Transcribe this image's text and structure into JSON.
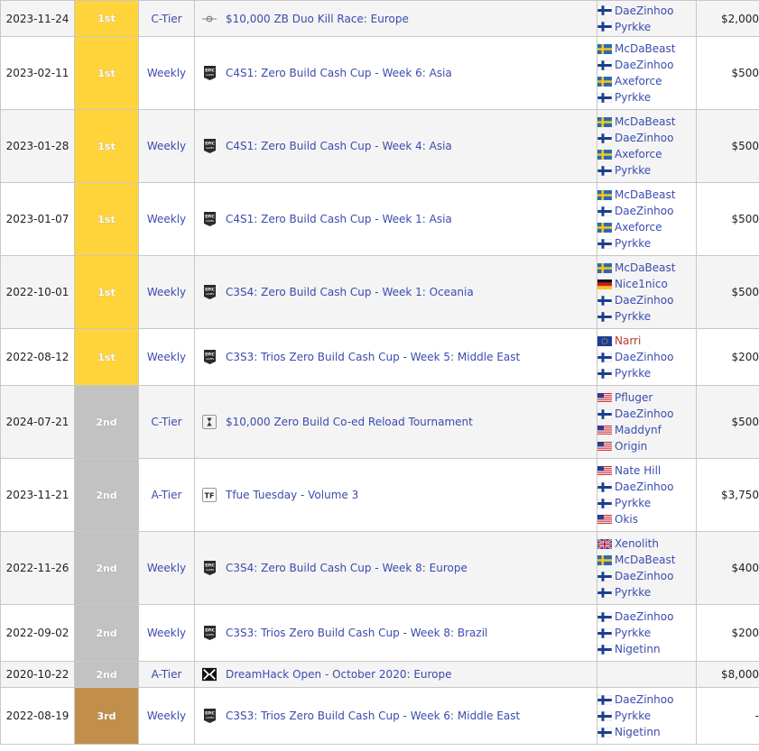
{
  "rows": [
    {
      "date": "2023-11-24",
      "place": "1st",
      "place_class": "p1",
      "tier": "C-Tier",
      "icon": "crosshair",
      "tournament": "$10,000 ZB Duo Kill Race: Europe",
      "players": [
        {
          "name": "DaeZinhoo",
          "flag": "fi"
        },
        {
          "name": "Pyrkke",
          "flag": "fi"
        }
      ],
      "prize": "$2,000"
    },
    {
      "date": "2023-02-11",
      "place": "1st",
      "place_class": "p1",
      "tier": "Weekly",
      "icon": "epic",
      "tournament": "C4S1: Zero Build Cash Cup - Week 6: Asia",
      "players": [
        {
          "name": "McDaBeast",
          "flag": "se"
        },
        {
          "name": "DaeZinhoo",
          "flag": "fi"
        },
        {
          "name": "Axeforce",
          "flag": "se"
        },
        {
          "name": "Pyrkke",
          "flag": "fi"
        }
      ],
      "prize": "$500"
    },
    {
      "date": "2023-01-28",
      "place": "1st",
      "place_class": "p1",
      "tier": "Weekly",
      "icon": "epic",
      "tournament": "C4S1: Zero Build Cash Cup - Week 4: Asia",
      "players": [
        {
          "name": "McDaBeast",
          "flag": "se"
        },
        {
          "name": "DaeZinhoo",
          "flag": "fi"
        },
        {
          "name": "Axeforce",
          "flag": "se"
        },
        {
          "name": "Pyrkke",
          "flag": "fi"
        }
      ],
      "prize": "$500"
    },
    {
      "date": "2023-01-07",
      "place": "1st",
      "place_class": "p1",
      "tier": "Weekly",
      "icon": "epic",
      "tournament": "C4S1: Zero Build Cash Cup - Week 1: Asia",
      "players": [
        {
          "name": "McDaBeast",
          "flag": "se"
        },
        {
          "name": "DaeZinhoo",
          "flag": "fi"
        },
        {
          "name": "Axeforce",
          "flag": "se"
        },
        {
          "name": "Pyrkke",
          "flag": "fi"
        }
      ],
      "prize": "$500"
    },
    {
      "date": "2022-10-01",
      "place": "1st",
      "place_class": "p1",
      "tier": "Weekly",
      "icon": "epic",
      "tournament": "C3S4: Zero Build Cash Cup - Week 1: Oceania",
      "players": [
        {
          "name": "McDaBeast",
          "flag": "se"
        },
        {
          "name": "Nice1nico",
          "flag": "de"
        },
        {
          "name": "DaeZinhoo",
          "flag": "fi"
        },
        {
          "name": "Pyrkke",
          "flag": "fi"
        }
      ],
      "prize": "$500"
    },
    {
      "date": "2022-08-12",
      "place": "1st",
      "place_class": "p1",
      "tier": "Weekly",
      "icon": "epic",
      "tournament": "C3S3: Trios Zero Build Cash Cup - Week 5: Middle East",
      "players": [
        {
          "name": "Narri",
          "flag": "eu",
          "red": true
        },
        {
          "name": "DaeZinhoo",
          "flag": "fi"
        },
        {
          "name": "Pyrkke",
          "flag": "fi"
        }
      ],
      "prize": "$200"
    },
    {
      "date": "2024-07-21",
      "place": "2nd",
      "place_class": "p2",
      "tier": "C-Tier",
      "icon": "hourglass",
      "tournament": "$10,000 Zero Build Co-ed Reload Tournament",
      "players": [
        {
          "name": "Pfluger",
          "flag": "us"
        },
        {
          "name": "DaeZinhoo",
          "flag": "fi"
        },
        {
          "name": "Maddynf",
          "flag": "us"
        },
        {
          "name": "Origin",
          "flag": "us"
        }
      ],
      "prize": "$500"
    },
    {
      "date": "2023-11-21",
      "place": "2nd",
      "place_class": "p2",
      "tier": "A-Tier",
      "icon": "tfue",
      "tournament": "Tfue Tuesday - Volume 3",
      "players": [
        {
          "name": "Nate Hill",
          "flag": "us"
        },
        {
          "name": "DaeZinhoo",
          "flag": "fi"
        },
        {
          "name": "Pyrkke",
          "flag": "fi"
        },
        {
          "name": "Okis",
          "flag": "us"
        }
      ],
      "prize": "$3,750"
    },
    {
      "date": "2022-11-26",
      "place": "2nd",
      "place_class": "p2",
      "tier": "Weekly",
      "icon": "epic",
      "tournament": "C3S4: Zero Build Cash Cup - Week 8: Europe",
      "players": [
        {
          "name": "Xenolith",
          "flag": "gb"
        },
        {
          "name": "McDaBeast",
          "flag": "se"
        },
        {
          "name": "DaeZinhoo",
          "flag": "fi"
        },
        {
          "name": "Pyrkke",
          "flag": "fi"
        }
      ],
      "prize": "$400"
    },
    {
      "date": "2022-09-02",
      "place": "2nd",
      "place_class": "p2",
      "tier": "Weekly",
      "icon": "epic",
      "tournament": "C3S3: Trios Zero Build Cash Cup - Week 8: Brazil",
      "players": [
        {
          "name": "DaeZinhoo",
          "flag": "fi"
        },
        {
          "name": "Pyrkke",
          "flag": "fi"
        },
        {
          "name": "Nigetinn",
          "flag": "fi"
        }
      ],
      "prize": "$200"
    },
    {
      "date": "2020-10-22",
      "place": "2nd",
      "place_class": "p2",
      "tier": "A-Tier",
      "icon": "dreamhack",
      "tournament": "DreamHack Open - October 2020: Europe",
      "players": [],
      "prize": "$8,000"
    },
    {
      "date": "2022-08-19",
      "place": "3rd",
      "place_class": "p3",
      "tier": "Weekly",
      "icon": "epic",
      "tournament": "C3S3: Trios Zero Build Cash Cup - Week 6: Middle East",
      "players": [
        {
          "name": "DaeZinhoo",
          "flag": "fi"
        },
        {
          "name": "Pyrkke",
          "flag": "fi"
        },
        {
          "name": "Nigetinn",
          "flag": "fi"
        }
      ],
      "prize": "-"
    }
  ],
  "colors": {
    "link": "#3a4cae",
    "place_1st": "#ffd43a",
    "place_2nd": "#c2c2c2",
    "place_3rd": "#c28f4a",
    "border": "#c8c8c8",
    "row_alt": "#f4f4f4"
  }
}
